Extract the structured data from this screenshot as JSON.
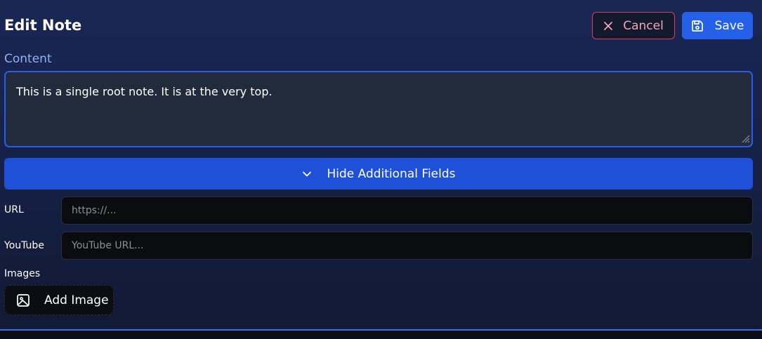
{
  "header": {
    "title": "Edit Note",
    "cancel_label": "Cancel",
    "save_label": "Save"
  },
  "content": {
    "label": "Content",
    "value": "This is a single root note. It is at the very top."
  },
  "toggle": {
    "label": "Hide Additional Fields",
    "icon": "chevron-down-icon"
  },
  "url": {
    "label": "URL",
    "placeholder": "https://..."
  },
  "youtube": {
    "label": "YouTube",
    "placeholder": "YouTube URL..."
  },
  "images": {
    "label": "Images",
    "add_label": "Add Image",
    "icon": "image-icon"
  },
  "colors": {
    "accent": "#2560e8",
    "cancel_border": "#d9405a",
    "label_blue": "#8fb2f5",
    "background": "#17224a"
  }
}
